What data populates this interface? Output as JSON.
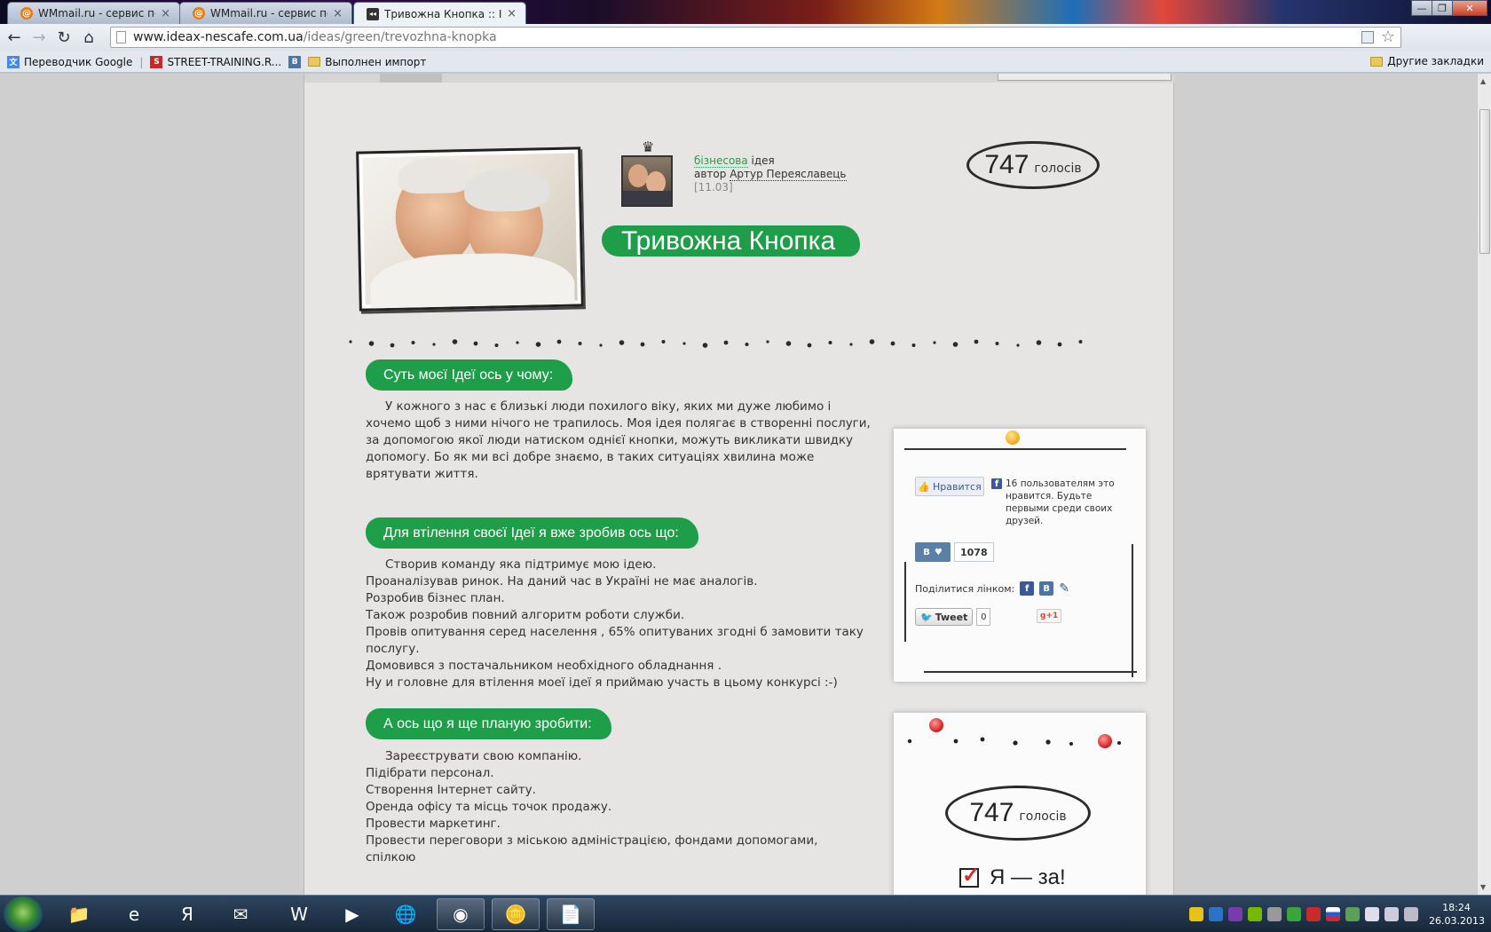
{
  "browser": {
    "tabs": [
      {
        "title": "WMmail.ru - сервис почт",
        "favicon": "wmmail-icon"
      },
      {
        "title": "WMmail.ru - сервис почт",
        "favicon": "wmmail-icon"
      },
      {
        "title": "Тривожна Кнопка :: Ідея",
        "favicon": "ideax-icon",
        "active": true
      }
    ],
    "url_host": "www.ideax-nescafe.com.ua",
    "url_path": "/ideas/green/trevozhna-knopka",
    "bookmarks": [
      "Переводчик Google",
      "STREET-TRAINING.R...",
      "Выполнен импорт"
    ],
    "other_bookmarks": "Другие закладки"
  },
  "idea": {
    "category": "бізнесова",
    "category_suffix": "ідея",
    "author_prefix": "автор",
    "author": "Артур Переяславець",
    "date": "[11.03]",
    "title": "Тривожна Кнопка",
    "votes": "747",
    "votes_label": "голосів"
  },
  "sections": [
    {
      "heading": "Суть моєї Ідеї ось у чому:",
      "text": "У кожного з нас є близькі люди похилого віку, яких ми дуже любимо і хочемо щоб з ними нічого не трапилось. Моя ідея полягає в створенні послуги, за допомогою якої люди натиском однієї кнопки, можуть викликати швидку допомогу. Бо як ми всі добре знаємо, в таких ситуаціях хвилина може врятувати життя."
    },
    {
      "heading": "Для втілення своєї Ідеї я вже зробив ось що:",
      "lines": [
        "Створив команду яка підтримує мою ідею.",
        "Проаналізував ринок. На даний час в Україні не має аналогів.",
        "Розробив бізнес план.",
        "Також розробив повний алгоритм роботи служби.",
        "Провів опитування серед населення , 65% опитуваних згодні б замовити таку послугу.",
        "Домовився з постачальником необхідного обладнання .",
        "Ну и головне для втілення моеї ідеї я приймаю участь в цьому конкурсі :-)"
      ]
    },
    {
      "heading": "А ось що я ще планую зробити:",
      "lines": [
        "Зареєструвати свою компанію.",
        "Підібрати персонал.",
        "Створення Інтернет сайту.",
        "Оренда офісу та місць точок продажу.",
        "Провести маркетинг.",
        "Провести переговори з міською адміністрацією, фондами допомогами, спілкою"
      ]
    }
  ],
  "social": {
    "fb_like": "Нравится",
    "fb_text": "16 пользователям это нравится. Будьте первыми среди своих друзей.",
    "vk_label": "В",
    "vk_count": "1078",
    "share_label": "Поділитися лінком:",
    "tweet": "Tweet",
    "tweet_count": "0",
    "gplus": "+1"
  },
  "vote_box": {
    "votes": "747",
    "votes_label": "голосів",
    "cta": "Я — за!"
  },
  "taskbar": {
    "time": "18:24",
    "date": "26.03.2013"
  },
  "colors": {
    "accent_green": "#1f9e4a"
  }
}
